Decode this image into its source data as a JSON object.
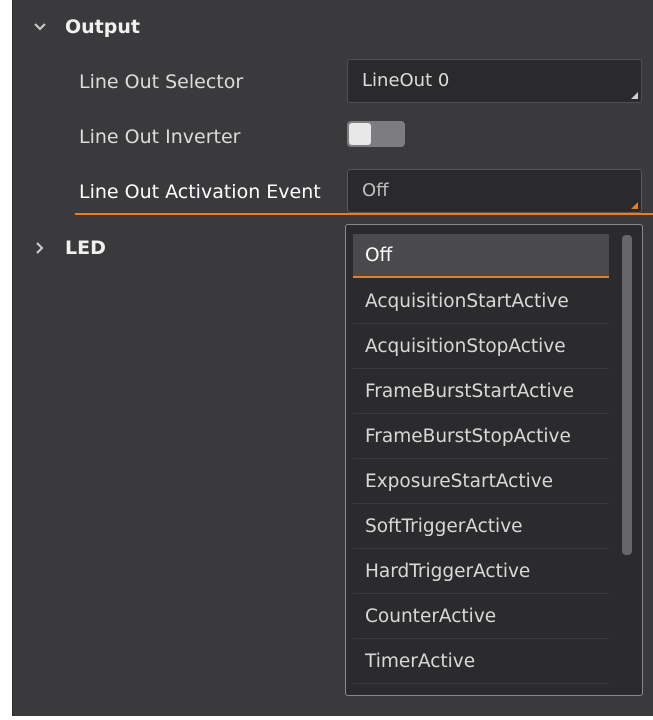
{
  "groups": {
    "output": {
      "title": "Output",
      "expanded": true,
      "icon": "chevron-down-icon"
    },
    "led": {
      "title": "LED",
      "expanded": false,
      "icon": "chevron-right-icon"
    }
  },
  "properties": {
    "line_out_selector": {
      "label": "Line Out Selector",
      "value": "LineOut 0"
    },
    "line_out_inverter": {
      "label": "Line Out Inverter",
      "value": false
    },
    "line_out_activation_event": {
      "label": "Line Out Activation Event",
      "value": "Off"
    }
  },
  "dropdown": {
    "options": [
      "Off",
      "AcquisitionStartActive",
      "AcquisitionStopActive",
      "FrameBurstStartActive",
      "FrameBurstStopActive",
      "ExposureStartActive",
      "SoftTriggerActive",
      "HardTriggerActive",
      "CounterActive",
      "TimerActive"
    ],
    "selected": "Off"
  },
  "colors": {
    "panel_background": "#3a3a3c",
    "field_background": "#2a2a2c",
    "accent": "#e87d23",
    "text": "#dcdcdc"
  }
}
